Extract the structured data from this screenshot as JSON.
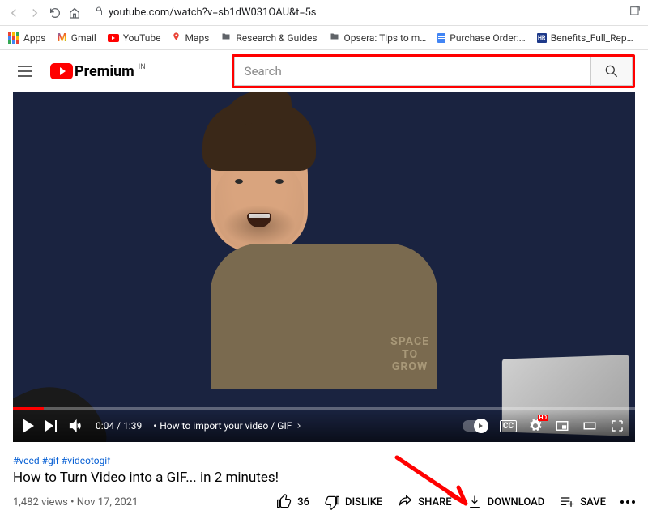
{
  "browser": {
    "url": "youtube.com/watch?v=sb1dW031OAU&t=5s",
    "bookmarks": [
      {
        "label": "Apps",
        "icon": "apps"
      },
      {
        "label": "Gmail",
        "icon": "gmail"
      },
      {
        "label": "YouTube",
        "icon": "youtube"
      },
      {
        "label": "Maps",
        "icon": "maps"
      },
      {
        "label": "Research & Guides",
        "icon": "folder"
      },
      {
        "label": "Opsera: Tips to m…",
        "icon": "folder"
      },
      {
        "label": "Purchase Order:…",
        "icon": "docs"
      },
      {
        "label": "Benefits_Full_Rep…",
        "icon": "hr"
      }
    ]
  },
  "header": {
    "logo_text": "Premium",
    "region": "IN",
    "search_placeholder": "Search"
  },
  "player": {
    "current_time": "0:04",
    "duration": "1:39",
    "chapter": "How to import your video / GIF",
    "shirt_line1": "SPACE",
    "shirt_line2": "TO",
    "shirt_line3": "GROW",
    "hd_label": "HD",
    "cc_label": "CC"
  },
  "video": {
    "hashtags": [
      "#veed",
      "#gif",
      "#videotogif"
    ],
    "title": "How to Turn Video into a GIF... in 2 minutes!",
    "views": "1,482 views",
    "date": "Nov 17, 2021",
    "likes": "36",
    "dislike_label": "DISLIKE",
    "share_label": "SHARE",
    "download_label": "DOWNLOAD",
    "save_label": "SAVE"
  }
}
